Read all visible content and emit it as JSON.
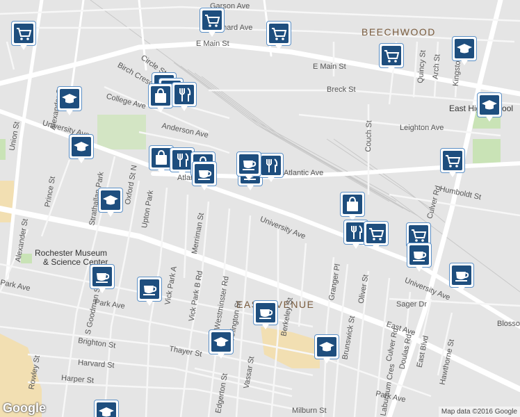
{
  "map": {
    "neighborhoods": [
      "BEECHWOOD",
      "EAST AVENUE"
    ],
    "streets": [
      "Garson Ave",
      "Bernard Ave",
      "E Main St",
      "E Main St",
      "Circle St",
      "Birch Crescent",
      "College Ave",
      "Breck St",
      "Alexander St",
      "Anderson Ave",
      "University Ave",
      "Leighton Ave",
      "Atlantic Ave",
      "Atlantic Ave",
      "Humboldt St",
      "Prince St",
      "Strathallan Park",
      "Oxford St N",
      "Upton Park",
      "Merriman St",
      "University Ave",
      "University Ave",
      "Culver Rd",
      "Couch St",
      "Quincy St",
      "Arch St",
      "Kingston St",
      "Granger Pl",
      "Oliver St",
      "Sager Dr",
      "Park Ave",
      "Park Ave",
      "Park Ave",
      "Vick Park A",
      "Vick Park B Rd",
      "Westminster Rd",
      "Arlington St",
      "Berkeley St",
      "Brighton St",
      "Harvard St",
      "Harper St",
      "Thayer St",
      "Rowley St",
      "S Goodman St",
      "Vassar St",
      "Edgerton St",
      "Brunswick St",
      "Oliver St",
      "Doulas Rd",
      "East Blvd",
      "Hawthorne St",
      "Culver Rd",
      "Milburn St",
      "Laburnum Cres",
      "East Ave",
      "East Ave",
      "Blossom Rd",
      "Brunswick St",
      "Alexander St",
      "Union St"
    ],
    "poi_labels": [
      "Rochester Museum",
      "& Science Center",
      "East High School"
    ],
    "attribution": "Map data ©2016 Google",
    "logo_text": "Google",
    "colors": {
      "land": "#e5e5e5",
      "road": "#ffffff",
      "park": "#c9e3b6",
      "marker": "#1e4e7e",
      "marker_border": "#5a8fc6",
      "highlight": "#f2dfb2"
    }
  },
  "markers": [
    {
      "name": "marker-grocery-1",
      "icon": "cart"
    },
    {
      "name": "marker-grocery-2",
      "icon": "cart"
    },
    {
      "name": "marker-grocery-3",
      "icon": "cart"
    },
    {
      "name": "marker-grocery-4",
      "icon": "cart"
    },
    {
      "name": "marker-school-1",
      "icon": "school"
    },
    {
      "name": "marker-restaurant-1",
      "icon": "restaurant"
    },
    {
      "name": "marker-restaurant-2",
      "icon": "restaurant"
    },
    {
      "name": "marker-shop-1",
      "icon": "bag"
    },
    {
      "name": "marker-restaurant-3",
      "icon": "restaurant"
    },
    {
      "name": "marker-school-2",
      "icon": "school"
    },
    {
      "name": "marker-school-3",
      "icon": "school"
    },
    {
      "name": "marker-shop-2",
      "icon": "bag"
    },
    {
      "name": "marker-restaurant-4",
      "icon": "restaurant"
    },
    {
      "name": "marker-shop-3",
      "icon": "bag"
    },
    {
      "name": "marker-cafe-1",
      "icon": "cafe"
    },
    {
      "name": "marker-cafe-2",
      "icon": "cafe"
    },
    {
      "name": "marker-restaurant-5",
      "icon": "restaurant"
    },
    {
      "name": "marker-cafe-3",
      "icon": "cafe"
    },
    {
      "name": "marker-grocery-5",
      "icon": "cart"
    },
    {
      "name": "marker-school-4",
      "icon": "school"
    },
    {
      "name": "marker-school-5",
      "icon": "school"
    },
    {
      "name": "marker-shop-4",
      "icon": "bag"
    },
    {
      "name": "marker-restaurant-6",
      "icon": "restaurant"
    },
    {
      "name": "marker-grocery-6",
      "icon": "cart"
    },
    {
      "name": "marker-grocery-7",
      "icon": "cart"
    },
    {
      "name": "marker-cafe-4",
      "icon": "cafe"
    },
    {
      "name": "marker-cafe-5",
      "icon": "cafe"
    },
    {
      "name": "marker-cafe-6",
      "icon": "cafe"
    },
    {
      "name": "marker-cafe-7",
      "icon": "cafe"
    },
    {
      "name": "marker-cafe-8",
      "icon": "cafe"
    },
    {
      "name": "marker-school-6",
      "icon": "school"
    },
    {
      "name": "marker-school-7",
      "icon": "school"
    },
    {
      "name": "marker-school-8",
      "icon": "school"
    }
  ]
}
